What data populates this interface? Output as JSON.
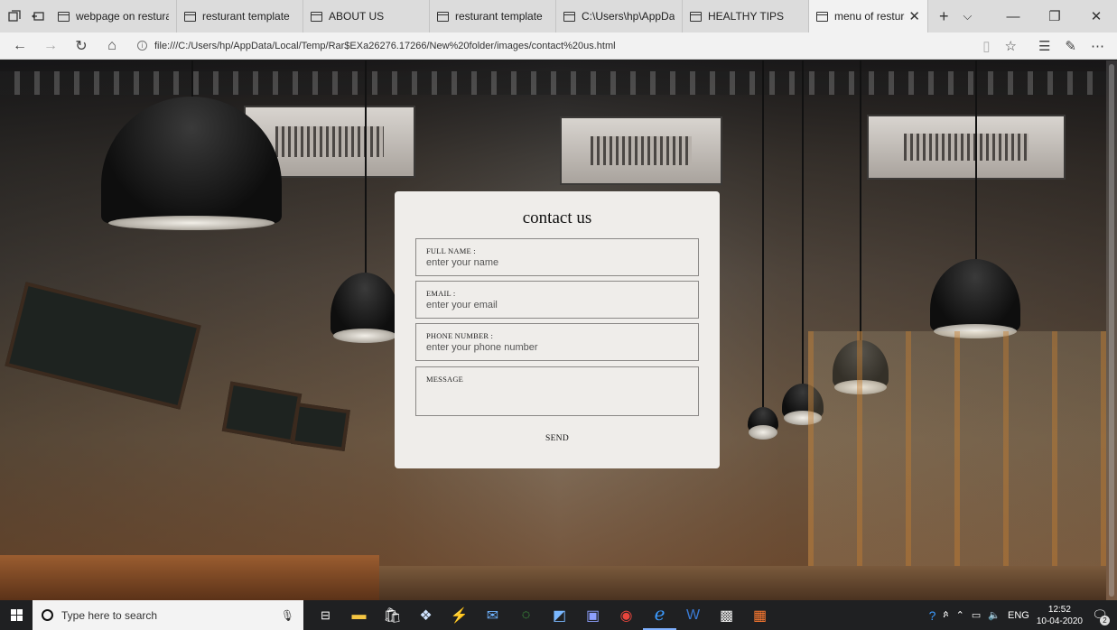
{
  "browser": {
    "tabs": [
      {
        "label": "webpage on resturant",
        "active": false
      },
      {
        "label": "resturant template",
        "active": false
      },
      {
        "label": "ABOUT US",
        "active": false
      },
      {
        "label": "resturant template",
        "active": false
      },
      {
        "label": "C:\\Users\\hp\\AppData\\L",
        "active": false
      },
      {
        "label": "HEALTHY TIPS",
        "active": false
      },
      {
        "label": "menu of resturant",
        "active": true
      }
    ],
    "url": "file:///C:/Users/hp/AppData/Local/Temp/Rar$EXa26276.17266/New%20folder/images/contact%20us.html",
    "icons": {
      "set_aside": "tab-set-aside-icon",
      "restore_tabs": "restore-tabs-icon",
      "back": "back-arrow-icon",
      "forward": "forward-arrow-icon",
      "refresh": "refresh-icon",
      "home": "home-icon",
      "reading_view": "reading-view-icon",
      "favorite": "star-icon",
      "favorites_bar": "favorites-list-icon",
      "notes": "pen-icon",
      "more": "ellipsis-icon"
    }
  },
  "contact": {
    "title": "contact us",
    "fields": {
      "name": {
        "label": "FULL NAME :",
        "placeholder": "enter your name"
      },
      "email": {
        "label": "EMAIL :",
        "placeholder": "enter your email"
      },
      "phone": {
        "label": "PHONE NUMBER :",
        "placeholder": "enter your phone number"
      },
      "message": {
        "label": "MESSAGE"
      }
    },
    "send_label": "SEND"
  },
  "taskbar": {
    "search_placeholder": "Type here to search",
    "tray": {
      "language": "ENG",
      "time": "12:52",
      "date": "10-04-2020",
      "notifications": "2"
    }
  }
}
